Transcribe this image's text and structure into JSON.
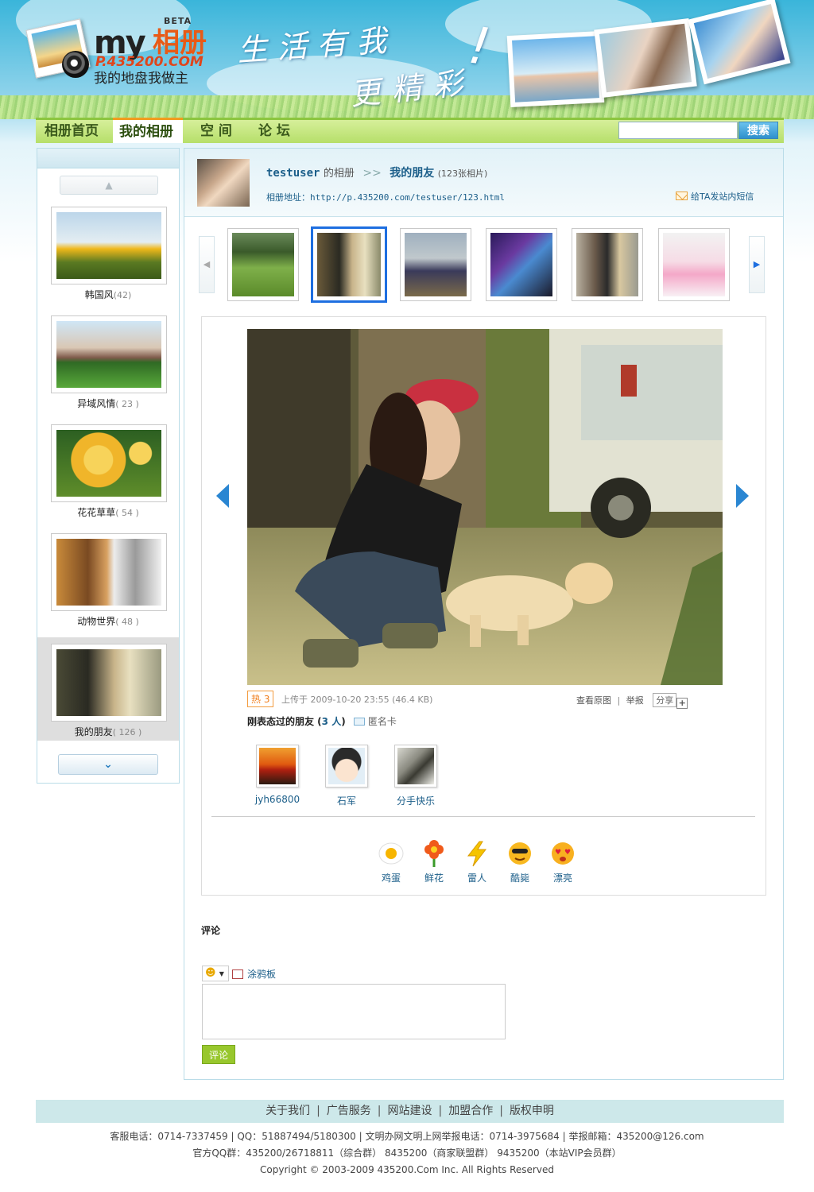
{
  "header": {
    "logo_my": "my",
    "logo_xiangce": "相册",
    "logo_beta": "BETA",
    "logo_url": "P.435200.COM",
    "logo_slogan": "我的地盘我做主",
    "banner_line1": "生活有我",
    "banner_line2": "更精彩",
    "banner_mark": "!"
  },
  "nav": {
    "items": [
      "相册首页",
      "我的相册",
      "空 间",
      "论 坛"
    ],
    "active_index": 1,
    "search_value": "",
    "search_button": "搜索"
  },
  "sidebar": {
    "up_icon": "chevron-up-icon",
    "down_icon": "chevron-down-icon",
    "albums": [
      {
        "name": "韩国风",
        "count": "(42)"
      },
      {
        "name": "异域风情",
        "count": "( 23 )"
      },
      {
        "name": "花花草草",
        "count": "( 54 )"
      },
      {
        "name": "动物世界",
        "count": "( 48 )"
      },
      {
        "name": "我的朋友",
        "count": "( 126 )"
      }
    ],
    "active_album": 4
  },
  "album_info": {
    "owner": "testuser",
    "of_label": "的相册",
    "separator": ">>",
    "album_name": "我的朋友",
    "photo_count": "(123张相片)",
    "address_label": "相册地址：",
    "address_url": "http://p.435200.com/testuser/123.html",
    "message_link": "给TA发站内短信"
  },
  "thumbnails": {
    "count": 6,
    "active_index": 1
  },
  "photo": {
    "hot_label": "热 3",
    "upload_info": "上传于 2009-10-20 23:55  (46.4 KB)",
    "view_original": "查看原图",
    "action_sep": "|",
    "report": "举报",
    "share": "分享",
    "share_plus": "+"
  },
  "visitors": {
    "title_prefix": "刚表态过的朋友 (",
    "title_count": "3 人",
    "title_suffix": ")",
    "anonymous_card": "匿名卡",
    "list": [
      {
        "name": "jyh66800"
      },
      {
        "name": "石军"
      },
      {
        "name": "分手快乐"
      }
    ]
  },
  "reactions": [
    {
      "label": "鸡蛋",
      "icon": "egg-icon"
    },
    {
      "label": "鲜花",
      "icon": "flower-icon"
    },
    {
      "label": "雷人",
      "icon": "lightning-icon"
    },
    {
      "label": "酷毙",
      "icon": "cool-face-icon"
    },
    {
      "label": "漂亮",
      "icon": "heart-eyes-icon"
    }
  ],
  "comments": {
    "title": "评论",
    "doodle": "涂鸦板",
    "input_value": "",
    "submit": "评论"
  },
  "footer": {
    "links": [
      "关于我们",
      "广告服务",
      "网站建设",
      "加盟合作",
      "版权申明"
    ],
    "link_sep": "|",
    "contact_line": "客服电话：0714-7337459 | QQ：51887494/5180300 | 文明办网文明上网举报电话：0714-3975684 | 举报邮箱：435200@126.com",
    "qq_groups_line": "官方QQ群：435200/26718811（综合群） 8435200（商家联盟群） 9435200（本站VIP会员群）",
    "copyright": "Copyright © 2003-2009 435200.Com Inc. All Rights Reserved"
  }
}
